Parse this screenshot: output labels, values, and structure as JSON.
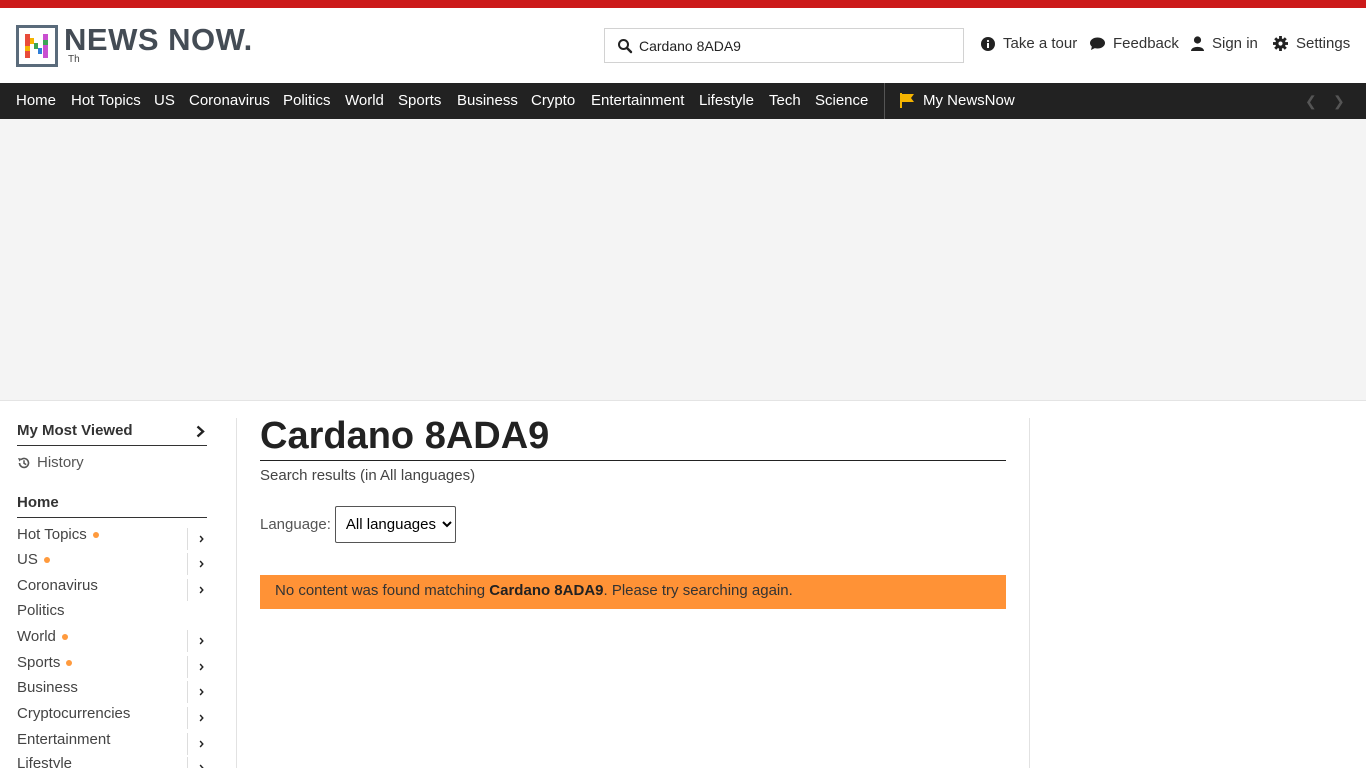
{
  "brand": {
    "name": "NEWS NOW.",
    "sub": "Th"
  },
  "search": {
    "value": "Cardano 8ADA9",
    "placeholder": "Search"
  },
  "header_links": {
    "tour": "Take a tour",
    "feedback": "Feedback",
    "signin": "Sign in",
    "settings": "Settings"
  },
  "nav": {
    "items": [
      "Home",
      "Hot Topics",
      "US",
      "Coronavirus",
      "Politics",
      "World",
      "Sports",
      "Business",
      "Crypto",
      "Entertainment",
      "Lifestyle",
      "Tech",
      "Science"
    ],
    "my_newsnow": "My NewsNow"
  },
  "sidebar": {
    "most_viewed": "My Most Viewed",
    "history": "History",
    "home": "Home",
    "items": [
      {
        "label": "Hot Topics",
        "dot": true,
        "chevron": true
      },
      {
        "label": "US",
        "dot": true,
        "chevron": true
      },
      {
        "label": "Coronavirus",
        "dot": false,
        "chevron": true
      },
      {
        "label": "Politics",
        "dot": false,
        "chevron": false
      },
      {
        "label": "World",
        "dot": true,
        "chevron": true
      },
      {
        "label": "Sports",
        "dot": true,
        "chevron": true
      },
      {
        "label": "Business",
        "dot": false,
        "chevron": true
      },
      {
        "label": "Cryptocurrencies",
        "dot": false,
        "chevron": true
      },
      {
        "label": "Entertainment",
        "dot": false,
        "chevron": true
      },
      {
        "label": "Lifestyle",
        "dot": false,
        "chevron": true
      }
    ]
  },
  "main": {
    "title": "Cardano 8ADA9",
    "subtitle": "Search results (in All languages)",
    "language_label": "Language:",
    "language_selected": "All languages",
    "notice_prefix": "No content was found matching ",
    "notice_query": "Cardano 8ADA9",
    "notice_suffix": ". Please try searching again."
  },
  "colors": {
    "accent_red": "#cc1a1a",
    "nav_bg": "#222222",
    "notice_bg": "#ff9236",
    "dot": "#ff9a3d",
    "flag": "#f5b400"
  }
}
